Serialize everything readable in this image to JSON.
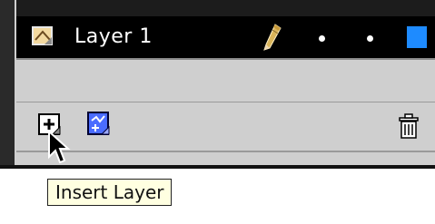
{
  "layer_row": {
    "name": "Layer 1",
    "color": "#1e8bff"
  },
  "icons": {
    "layer": "layer-icon",
    "pencil": "pencil-icon",
    "visible_dot": "visibility-dot",
    "lock_dot": "lock-dot",
    "insert_layer": "insert-layer-icon",
    "motion_guide": "motion-guide-icon",
    "trash": "trash-icon",
    "cursor": "mouse-cursor-icon"
  },
  "tooltip": {
    "text": "Insert Layer"
  }
}
